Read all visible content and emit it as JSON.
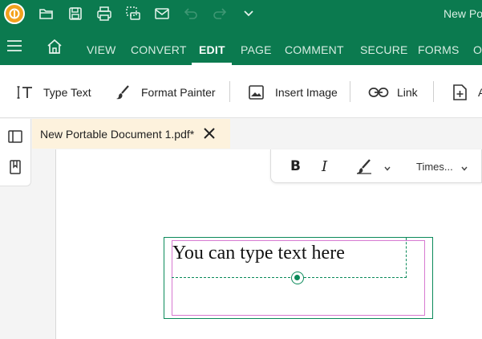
{
  "titlebar": {
    "document_title": "New Po",
    "icons": [
      "app-logo",
      "open-icon",
      "save-icon",
      "print-icon",
      "scan-icon",
      "mail-icon",
      "undo-icon",
      "redo-icon",
      "chevron-down-icon"
    ]
  },
  "menubar": {
    "tabs": [
      {
        "label": "VIEW"
      },
      {
        "label": "CONVERT"
      },
      {
        "label": "EDIT"
      },
      {
        "label": "PAGE"
      },
      {
        "label": "COMMENT"
      },
      {
        "label": "SECURE"
      },
      {
        "label": "FORMS"
      },
      {
        "label": "O"
      }
    ],
    "active_tab": "EDIT"
  },
  "toolbar": {
    "type_text": "Type Text",
    "format_painter": "Format Painter",
    "insert_image": "Insert Image",
    "link": "Link",
    "more": "A"
  },
  "doctab": {
    "label": "New Portable Document 1.pdf*"
  },
  "format_bar": {
    "bold": "B",
    "italic": "I",
    "font": "Times..."
  },
  "textbox": {
    "text": "You can type text here"
  },
  "colors": {
    "brand_green": "#0b7a4f",
    "selection_magenta": "#d77ad1",
    "tab_highlight": "#fdf2dd"
  }
}
